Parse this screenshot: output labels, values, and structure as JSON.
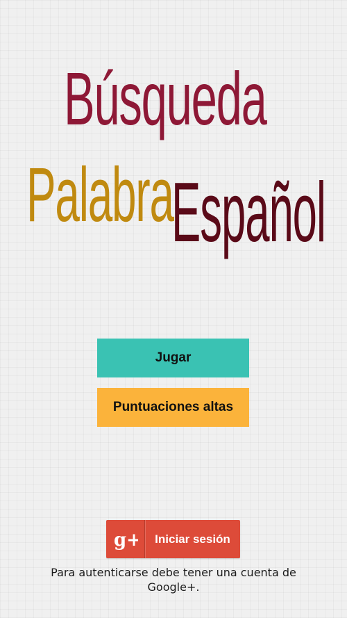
{
  "title": {
    "line1": "Búsqueda",
    "line2_left": "Palabra",
    "line2_right": "Español"
  },
  "menu": {
    "play_label": "Jugar",
    "scores_label": "Puntuaciones altas"
  },
  "signin": {
    "icon": "google-plus-icon",
    "icon_glyph": "g+",
    "label": "Iniciar sesión",
    "note": "Para autenticarse debe tener una cuenta de Google+."
  },
  "colors": {
    "title_line1": "#8e1836",
    "title_palabra": "#c08a10",
    "title_espanol": "#5a0a18",
    "play_button": "#3ac2b3",
    "scores_button": "#fbb33b",
    "signin_button": "#dd4b39"
  }
}
